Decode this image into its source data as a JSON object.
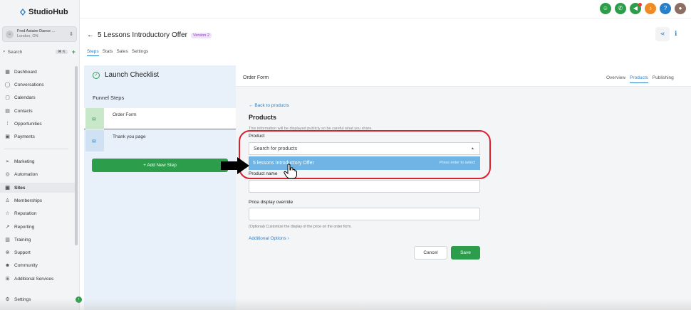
{
  "app": {
    "name": "StudioHub"
  },
  "account": {
    "name": "Fred Astaire Dance ...",
    "location": "London, ON"
  },
  "search": {
    "label": "Search",
    "shortcut": "⌘ K"
  },
  "nav": {
    "group1": [
      "Dashboard",
      "Conversations",
      "Calendars",
      "Contacts",
      "Opportunities",
      "Payments"
    ],
    "group2": [
      "Marketing",
      "Automation",
      "Sites",
      "Memberships",
      "Reputation",
      "Reporting",
      "Training",
      "Support",
      "Community",
      "Additional Services"
    ],
    "settings": "Settings",
    "active": "Sites"
  },
  "page": {
    "title": "5 Lessons Introductory Offer",
    "version": "Version 2"
  },
  "tabs": [
    "Steps",
    "Stats",
    "Sales",
    "Settings"
  ],
  "checklist": {
    "title": "Launch Checklist",
    "funnel_steps": "Funnel Steps"
  },
  "steps": [
    {
      "label": "Order Form"
    },
    {
      "label": "Thank you page"
    }
  ],
  "add_step": "Add New Step",
  "panel": {
    "title": "Order Form",
    "tabs": [
      "Overview",
      "Products",
      "Publishing"
    ],
    "active_tab": "Products"
  },
  "form": {
    "back": "Back to products",
    "heading": "Products",
    "info": "This information will be displayed publicly so be careful what you share.",
    "product_label": "Product",
    "product_placeholder": "Search for products",
    "option": "5 lessons Introductory Offer",
    "option_hint": "Press enter to select",
    "product_name_label": "Product name",
    "price_label": "Price display override",
    "price_hint": "(Optional) Customize the display of the price on the order form.",
    "additional": "Additional Options",
    "cancel": "Cancel",
    "save": "Save"
  },
  "colors": {
    "accent": "#2a7fc9",
    "green": "#2c9d4a",
    "highlight": "#d9202e"
  }
}
